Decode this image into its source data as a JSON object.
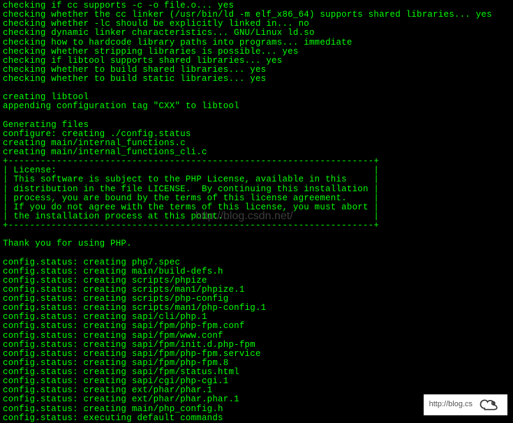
{
  "terminal": {
    "lines": [
      "checking if cc supports -c -o file.o... yes",
      "checking whether the cc linker (/usr/bin/ld -m elf_x86_64) supports shared libraries... yes",
      "checking whether -lc should be explicitly linked in... no",
      "checking dynamic linker characteristics... GNU/Linux ld.so",
      "checking how to hardcode library paths into programs... immediate",
      "checking whether stripping libraries is possible... yes",
      "checking if libtool supports shared libraries... yes",
      "checking whether to build shared libraries... yes",
      "checking whether to build static libraries... yes",
      "",
      "creating libtool",
      "appending configuration tag \"CXX\" to libtool",
      "",
      "Generating files",
      "configure: creating ./config.status",
      "creating main/internal_functions.c",
      "creating main/internal_functions_cli.c",
      "+--------------------------------------------------------------------+",
      "| License:                                                           |",
      "| This software is subject to the PHP License, available in this     |",
      "| distribution in the file LICENSE.  By continuing this installation |",
      "| process, you are bound by the terms of this license agreement.     |",
      "| If you do not agree with the terms of this license, you must abort |",
      "| the installation process at this point.                            |",
      "+--------------------------------------------------------------------+",
      "",
      "Thank you for using PHP.",
      "",
      "config.status: creating php7.spec",
      "config.status: creating main/build-defs.h",
      "config.status: creating scripts/phpize",
      "config.status: creating scripts/man1/phpize.1",
      "config.status: creating scripts/php-config",
      "config.status: creating scripts/man1/php-config.1",
      "config.status: creating sapi/cli/php.1",
      "config.status: creating sapi/fpm/php-fpm.conf",
      "config.status: creating sapi/fpm/www.conf",
      "config.status: creating sapi/fpm/init.d.php-fpm",
      "config.status: creating sapi/fpm/php-fpm.service",
      "config.status: creating sapi/fpm/php-fpm.8",
      "config.status: creating sapi/fpm/status.html",
      "config.status: creating sapi/cgi/php-cgi.1",
      "config.status: creating ext/phar/phar.1",
      "config.status: creating ext/phar/phar.phar.1",
      "config.status: creating main/php_config.h",
      "config.status: executing default commands"
    ]
  },
  "watermarks": {
    "center": "http://blog.csdn.net/",
    "corner_text": "http://blog.cs",
    "logo_name": "cloud-logo"
  }
}
